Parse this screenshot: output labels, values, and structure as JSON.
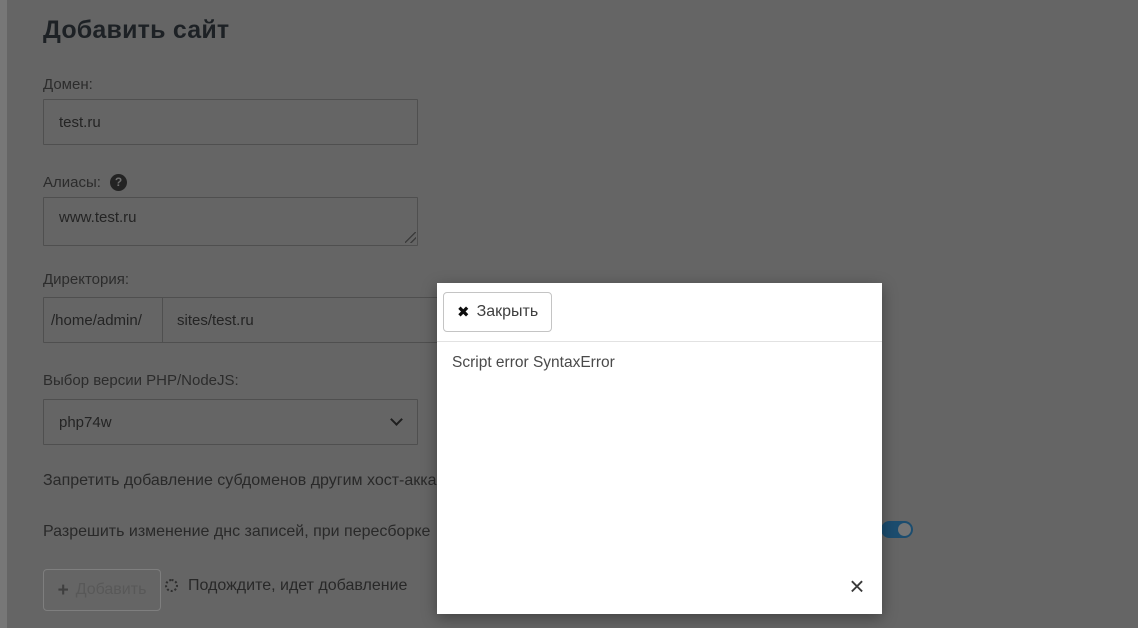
{
  "page": {
    "title": "Добавить сайт"
  },
  "form": {
    "domain": {
      "label": "Домен:",
      "value": "test.ru"
    },
    "aliases": {
      "label": "Алиасы:",
      "value": "www.test.ru"
    },
    "directory": {
      "label": "Директория:",
      "prefix": "/home/admin/",
      "value": "sites/test.ru"
    },
    "php": {
      "label": "Выбор версии PHP/NodeJS:",
      "selected": "php74w"
    },
    "deny_subdomains": {
      "label": "Запретить добавление субдоменов другим хост-акка"
    },
    "allow_dns": {
      "label": "Разрешить изменение днс записей, при пересборке",
      "toggle_state": "on"
    },
    "submit_button": {
      "label": "Добавить",
      "disabled": true
    },
    "progress_text": "Подождите, идет добавление"
  },
  "modal": {
    "close_button_label": "Закрыть",
    "body_text": "Script error SyntaxError"
  },
  "icons": {
    "help": "?",
    "close_bold": "✖",
    "close_thin": "×",
    "plus": "+"
  },
  "colors": {
    "backdrop": "#656565",
    "modal_bg": "#ffffff",
    "toggle_on": "#1c4d6f"
  }
}
